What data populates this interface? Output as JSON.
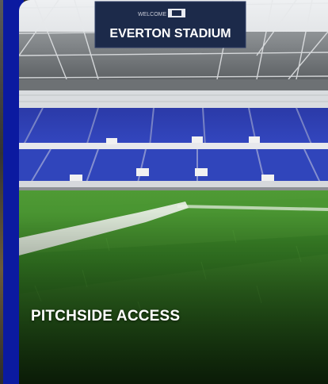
{
  "card": {
    "title": "PITCHSIDE ACCESS",
    "stadium_banner": {
      "small_text": "WELCOME TO",
      "name": "EVERTON STADIUM"
    }
  },
  "colors": {
    "accent": "#0b1aa0",
    "seats": "#2d3fb5",
    "grass": "#3f8f2a"
  },
  "icons": {
    "club_crest": "crest-icon"
  }
}
